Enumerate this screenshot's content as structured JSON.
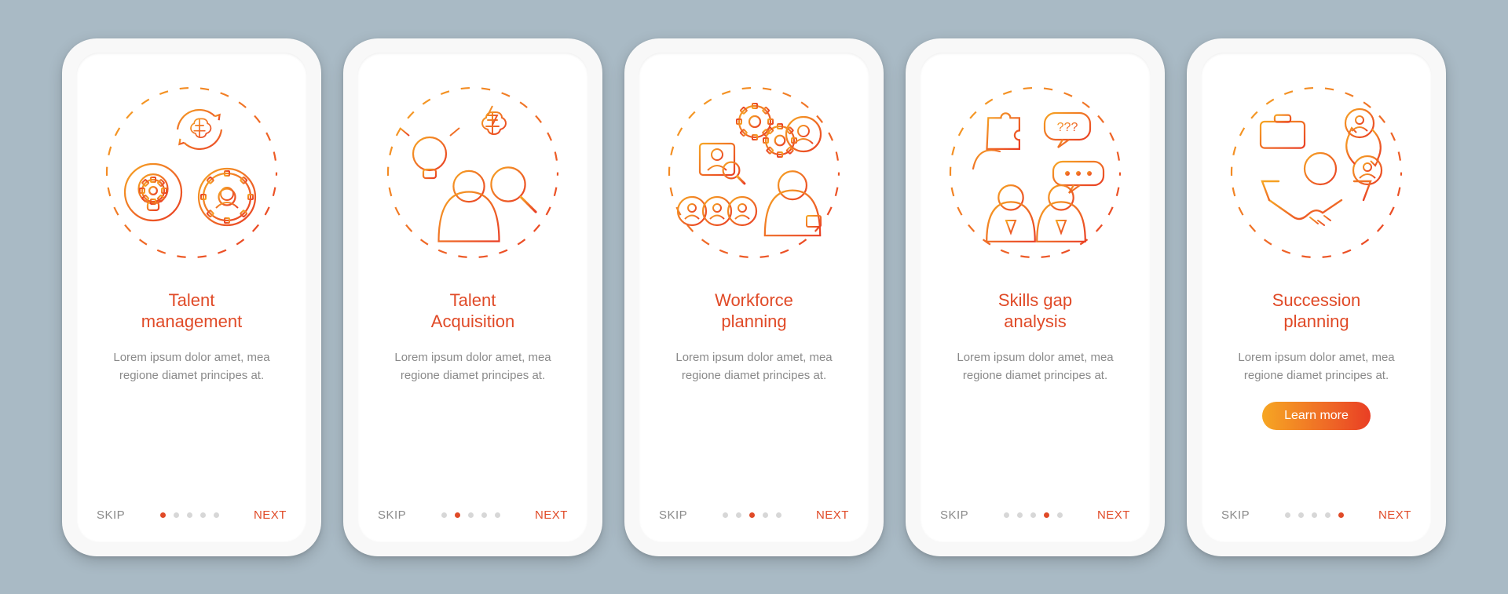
{
  "common": {
    "skip": "SKIP",
    "next": "NEXT",
    "learn_more": "Learn more",
    "description": "Lorem ipsum dolor amet, mea regione diamet principes at.",
    "total_dots": 5,
    "colors": {
      "accent": "#e04a27",
      "grad_start": "#f6a623",
      "grad_end": "#e93e24",
      "muted": "#8a8a8a",
      "bg": "#a9bac5"
    }
  },
  "screens": [
    {
      "title": "Talent\nmanagement",
      "active_dot": 0,
      "has_learn_more": false,
      "icon": "talent-management-icon"
    },
    {
      "title": "Talent\nAcquisition",
      "active_dot": 1,
      "has_learn_more": false,
      "icon": "talent-acquisition-icon"
    },
    {
      "title": "Workforce\nplanning",
      "active_dot": 2,
      "has_learn_more": false,
      "icon": "workforce-planning-icon"
    },
    {
      "title": "Skills gap\nanalysis",
      "active_dot": 3,
      "has_learn_more": false,
      "icon": "skills-gap-icon"
    },
    {
      "title": "Succession\nplanning",
      "active_dot": 4,
      "has_learn_more": true,
      "icon": "succession-planning-icon"
    }
  ]
}
